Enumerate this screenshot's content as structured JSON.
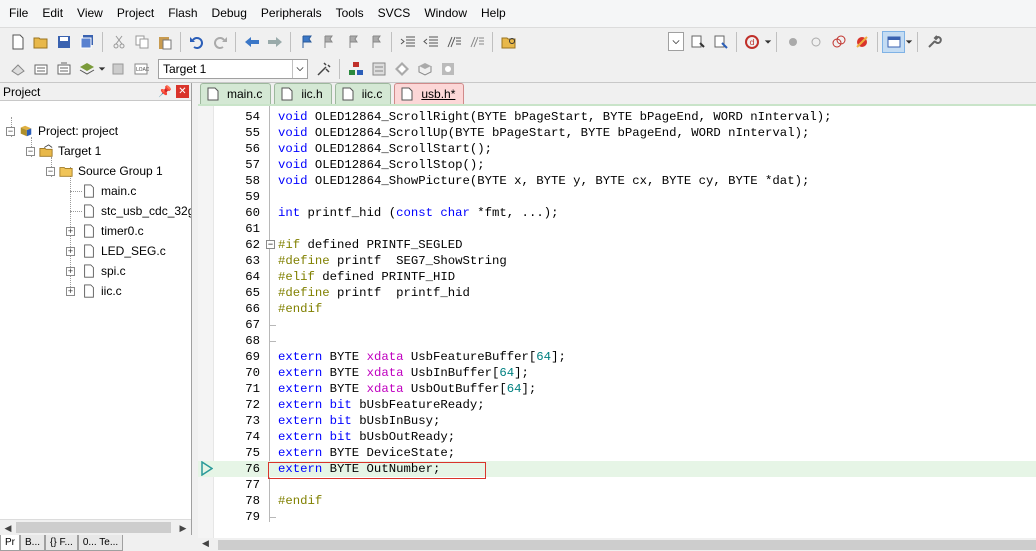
{
  "menu": [
    "File",
    "Edit",
    "View",
    "Project",
    "Flash",
    "Debug",
    "Peripherals",
    "Tools",
    "SVCS",
    "Window",
    "Help"
  ],
  "toolbar2": {
    "target": "Target 1"
  },
  "project_pane": {
    "title": "Project",
    "pin": "ᵖ",
    "close": "✕",
    "tree": {
      "project": "Project: project",
      "target": "Target 1",
      "group": "Source Group 1",
      "files": [
        "main.c",
        "stc_usb_cdc_32g",
        "timer0.c",
        "LED_SEG.c",
        "spi.c",
        "iic.c"
      ]
    },
    "bottom_tabs": [
      "Pr",
      "B...",
      "{} F...",
      "0... Te..."
    ]
  },
  "editor_tabs": [
    "main.c",
    "iic.h",
    "iic.c",
    "usb.h*"
  ],
  "code_lines": [
    {
      "n": "54",
      "t": "void OLED12864_ScrollRight(BYTE bPageStart, BYTE bPageEnd, WORD nInterval);"
    },
    {
      "n": "55",
      "t": "void OLED12864_ScrollUp(BYTE bPageStart, BYTE bPageEnd, WORD nInterval);"
    },
    {
      "n": "56",
      "t": "void OLED12864_ScrollStart();"
    },
    {
      "n": "57",
      "t": "void OLED12864_ScrollStop();"
    },
    {
      "n": "58",
      "t": "void OLED12864_ShowPicture(BYTE x, BYTE y, BYTE cx, BYTE cy, BYTE *dat);"
    },
    {
      "n": "59",
      "t": ""
    },
    {
      "n": "60",
      "t": "int printf_hid (const char *fmt, ...);"
    },
    {
      "n": "61",
      "t": ""
    },
    {
      "n": "62",
      "t": "#if defined PRINTF_SEGLED"
    },
    {
      "n": "63",
      "t": "#define printf  SEG7_ShowString"
    },
    {
      "n": "64",
      "t": "#elif defined PRINTF_HID"
    },
    {
      "n": "65",
      "t": "#define printf  printf_hid"
    },
    {
      "n": "66",
      "t": "#endif"
    },
    {
      "n": "67",
      "t": ""
    },
    {
      "n": "68",
      "t": ""
    },
    {
      "n": "69",
      "t": "extern BYTE xdata UsbFeatureBuffer[64];"
    },
    {
      "n": "70",
      "t": "extern BYTE xdata UsbInBuffer[64];"
    },
    {
      "n": "71",
      "t": "extern BYTE xdata UsbOutBuffer[64];"
    },
    {
      "n": "72",
      "t": "extern bit bUsbFeatureReady;"
    },
    {
      "n": "73",
      "t": "extern bit bUsbInBusy;"
    },
    {
      "n": "74",
      "t": "extern bit bUsbOutReady;"
    },
    {
      "n": "75",
      "t": "extern BYTE DeviceState;"
    },
    {
      "n": "76",
      "t": "extern BYTE OutNumber;"
    },
    {
      "n": "77",
      "t": ""
    },
    {
      "n": "78",
      "t": "#endif"
    },
    {
      "n": "79",
      "t": ""
    }
  ],
  "current_line": "76",
  "colors": {
    "keyword": "#0000ff",
    "preprocessor": "#808000",
    "number": "#008080",
    "xdata": "#c000c0",
    "highlight": "#e6f5e6",
    "active_tab": "#fcd7d7",
    "tab": "#d4e8d4"
  }
}
